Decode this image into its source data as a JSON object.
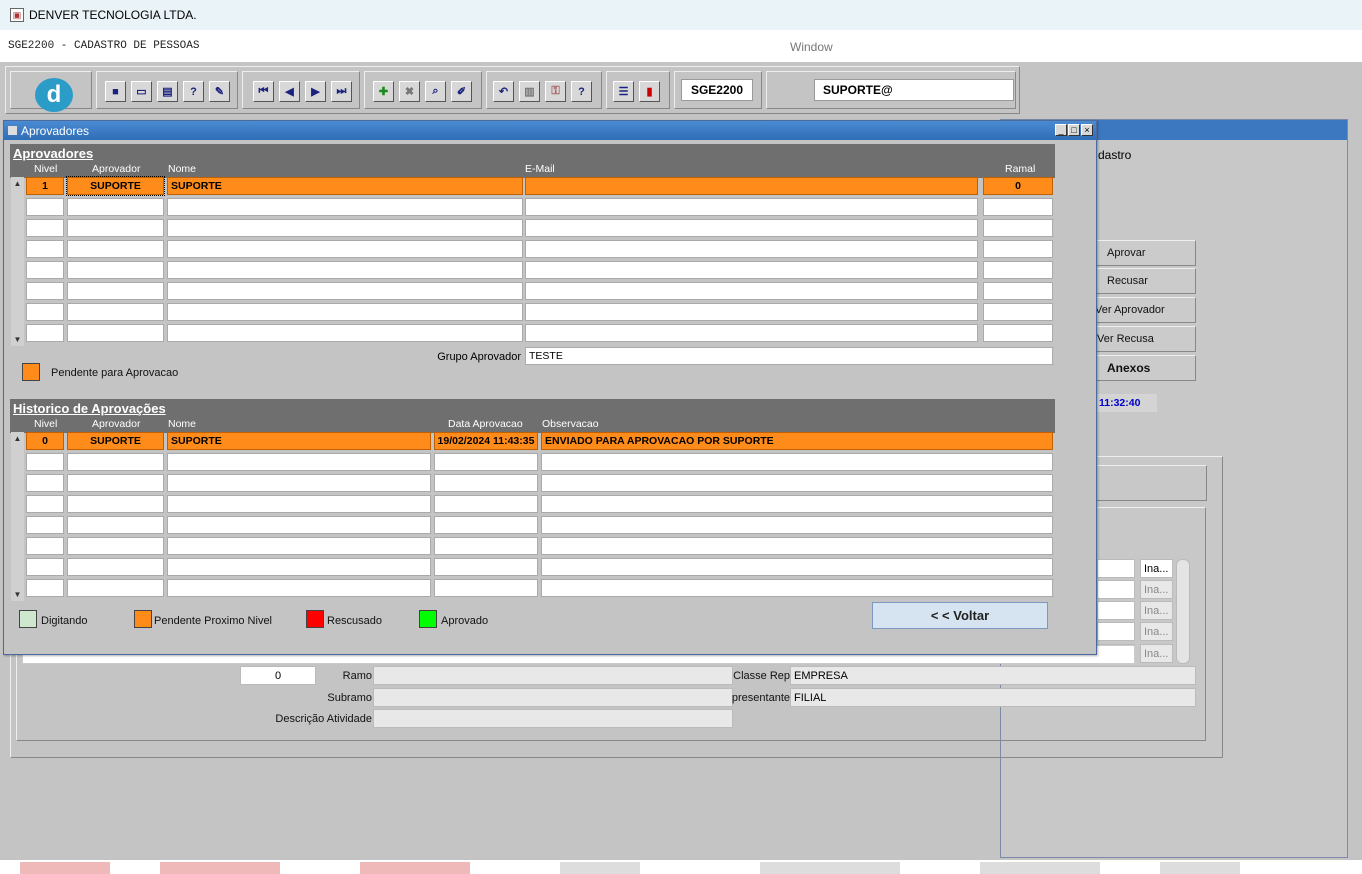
{
  "window": {
    "title": "DENVER TECNOLOGIA LTDA.",
    "form_name": "SGE2200 - CADASTRO DE PESSOAS",
    "menu_window": "Window"
  },
  "toolbar": {
    "form_code": "SGE2200",
    "user": "SUPORTE@",
    "buttons": [
      "save-icon",
      "window-icon",
      "print-icon",
      "query-icon",
      "wizard-icon",
      "first-record-icon",
      "prev-record-icon",
      "next-record-icon",
      "last-record-icon",
      "insert-record-icon",
      "delete-record-icon",
      "search-icon",
      "edit-icon",
      "undo-icon",
      "clipboard-icon",
      "key-icon",
      "help-icon",
      "menu-icon",
      "exit-icon"
    ]
  },
  "background": {
    "partial_title": "dastro",
    "buttons": {
      "aprovar": "Aprovar",
      "recusar": "Recusar",
      "ver_aprovador": "Ver Aprovador",
      "ver_recusa": "Ver Recusa",
      "anexos": "Anexos"
    },
    "time": "11:32:40",
    "ina_labels": [
      "Ina...",
      "Ina...",
      "Ina...",
      "Ina...",
      "Ina..."
    ],
    "ramo_value": "0",
    "ramo_label": "Ramo",
    "subramo_label": "Subramo",
    "descricao_label": "Descrição Atividade",
    "classe_label": "Classe Rep",
    "classe_value": "EMPRESA",
    "representante_label": "presentante",
    "representante_value": "FILIAL"
  },
  "dialog": {
    "title": "Aprovadores",
    "aprovadores": {
      "section_title": "Aprovadores",
      "columns": {
        "nivel": "Nivel",
        "aprovador": "Aprovador",
        "nome": "Nome",
        "email": "E-Mail",
        "ramal": "Ramal"
      },
      "rows": [
        {
          "nivel": "1",
          "aprovador": "SUPORTE",
          "nome": "SUPORTE",
          "email": "",
          "ramal": "0"
        }
      ],
      "grupo_label": "Grupo Aprovador",
      "grupo_value": "TESTE",
      "legend_pendente": "Pendente para Aprovacao"
    },
    "historico": {
      "section_title": "Historico de Aprovações",
      "columns": {
        "nivel": "Nivel",
        "aprovador": "Aprovador",
        "nome": "Nome",
        "data": "Data Aprovacao",
        "observacao": "Observacao"
      },
      "rows": [
        {
          "nivel": "0",
          "aprovador": "SUPORTE",
          "nome": "SUPORTE",
          "data": "19/02/2024 11:43:35",
          "observacao": "ENVIADO PARA APROVACAO POR SUPORTE"
        }
      ]
    },
    "legend": {
      "digitando": "Digitando",
      "pendente_proximo": "Pendente Proximo Nivel",
      "recusado": "Rescusado",
      "aprovado": "Aprovado"
    },
    "voltar_label": "< < Voltar"
  },
  "colors": {
    "orange": "#ff8c1a",
    "digitando": "#cfe6cf",
    "recusado": "#ff0000",
    "aprovado": "#00ff00",
    "title_blue": "#2f6db6"
  }
}
